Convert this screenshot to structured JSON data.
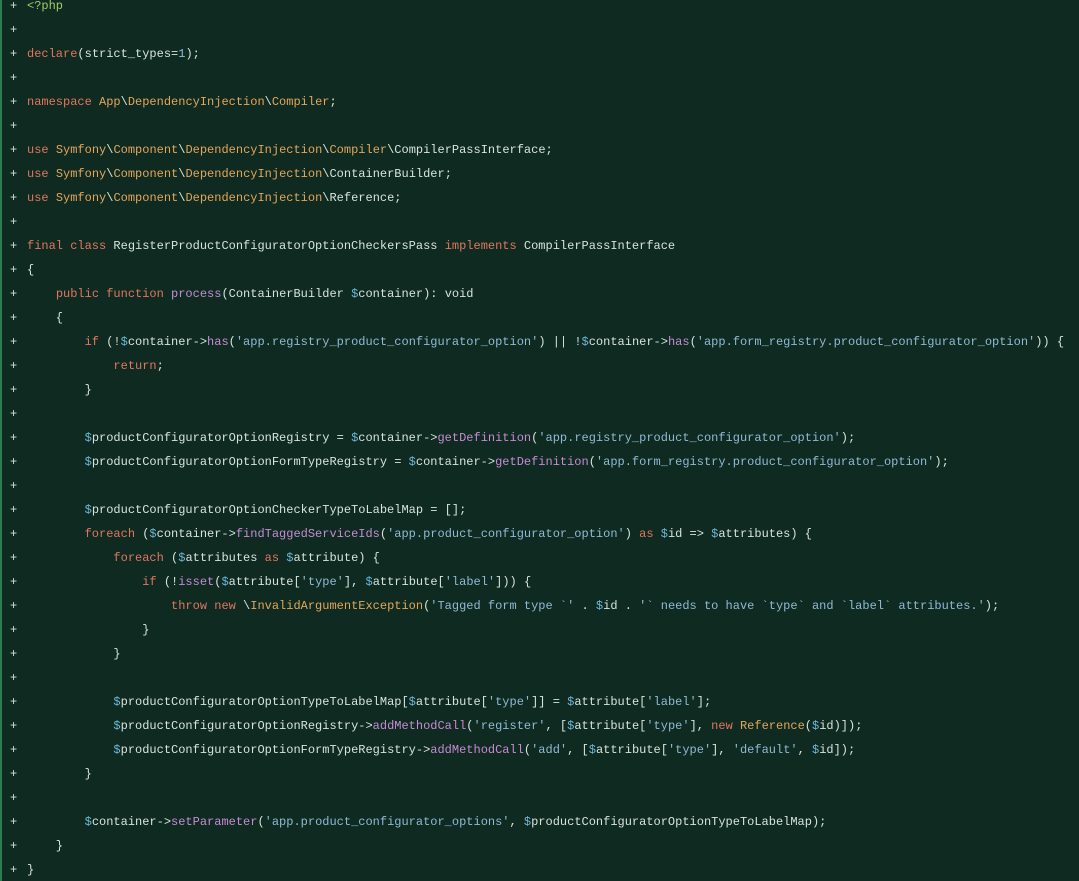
{
  "diff": {
    "marker": "+",
    "lines": [
      [
        [
          "tag",
          "<?php"
        ]
      ],
      [],
      [
        [
          "kw",
          "declare"
        ],
        [
          "plain",
          "(strict_types="
        ],
        [
          "num",
          "1"
        ],
        [
          "plain",
          ");"
        ]
      ],
      [],
      [
        [
          "kw",
          "namespace "
        ],
        [
          "ns",
          "App"
        ],
        [
          "plain",
          "\\"
        ],
        [
          "ns",
          "DependencyInjection"
        ],
        [
          "plain",
          "\\"
        ],
        [
          "ns",
          "Compiler"
        ],
        [
          "plain",
          ";"
        ]
      ],
      [],
      [
        [
          "kw",
          "use "
        ],
        [
          "ns",
          "Symfony"
        ],
        [
          "plain",
          "\\"
        ],
        [
          "ns",
          "Component"
        ],
        [
          "plain",
          "\\"
        ],
        [
          "ns",
          "DependencyInjection"
        ],
        [
          "plain",
          "\\"
        ],
        [
          "ns",
          "Compiler"
        ],
        [
          "plain",
          "\\CompilerPassInterface;"
        ]
      ],
      [
        [
          "kw",
          "use "
        ],
        [
          "ns",
          "Symfony"
        ],
        [
          "plain",
          "\\"
        ],
        [
          "ns",
          "Component"
        ],
        [
          "plain",
          "\\"
        ],
        [
          "ns",
          "DependencyInjection"
        ],
        [
          "plain",
          "\\ContainerBuilder;"
        ]
      ],
      [
        [
          "kw",
          "use "
        ],
        [
          "ns",
          "Symfony"
        ],
        [
          "plain",
          "\\"
        ],
        [
          "ns",
          "Component"
        ],
        [
          "plain",
          "\\"
        ],
        [
          "ns",
          "DependencyInjection"
        ],
        [
          "plain",
          "\\Reference;"
        ]
      ],
      [],
      [
        [
          "kw",
          "final class "
        ],
        [
          "plain",
          "RegisterProductConfiguratorOptionCheckersPass "
        ],
        [
          "kw",
          "implements "
        ],
        [
          "plain",
          "CompilerPassInterface"
        ]
      ],
      [
        [
          "plain",
          "{"
        ]
      ],
      [
        [
          "plain",
          "    "
        ],
        [
          "kw",
          "public function "
        ],
        [
          "fn",
          "process"
        ],
        [
          "plain",
          "(ContainerBuilder "
        ],
        [
          "var",
          "$"
        ],
        [
          "plain",
          "container): void"
        ]
      ],
      [
        [
          "plain",
          "    {"
        ]
      ],
      [
        [
          "plain",
          "        "
        ],
        [
          "kw",
          "if "
        ],
        [
          "plain",
          "(!"
        ],
        [
          "var",
          "$"
        ],
        [
          "plain",
          "container->"
        ],
        [
          "fn",
          "has"
        ],
        [
          "plain",
          "("
        ],
        [
          "str",
          "'app.registry_product_configurator_option'"
        ],
        [
          "plain",
          ") || !"
        ],
        [
          "var",
          "$"
        ],
        [
          "plain",
          "container->"
        ],
        [
          "fn",
          "has"
        ],
        [
          "plain",
          "("
        ],
        [
          "str",
          "'app.form_registry.product_configurator_option'"
        ],
        [
          "plain",
          ")) {"
        ]
      ],
      [
        [
          "plain",
          "            "
        ],
        [
          "kw",
          "return"
        ],
        [
          "plain",
          ";"
        ]
      ],
      [
        [
          "plain",
          "        }"
        ]
      ],
      [],
      [
        [
          "plain",
          "        "
        ],
        [
          "var",
          "$"
        ],
        [
          "plain",
          "productConfiguratorOptionRegistry = "
        ],
        [
          "var",
          "$"
        ],
        [
          "plain",
          "container->"
        ],
        [
          "fn",
          "getDefinition"
        ],
        [
          "plain",
          "("
        ],
        [
          "str",
          "'app.registry_product_configurator_option'"
        ],
        [
          "plain",
          ");"
        ]
      ],
      [
        [
          "plain",
          "        "
        ],
        [
          "var",
          "$"
        ],
        [
          "plain",
          "productConfiguratorOptionFormTypeRegistry = "
        ],
        [
          "var",
          "$"
        ],
        [
          "plain",
          "container->"
        ],
        [
          "fn",
          "getDefinition"
        ],
        [
          "plain",
          "("
        ],
        [
          "str",
          "'app.form_registry.product_configurator_option'"
        ],
        [
          "plain",
          ");"
        ]
      ],
      [],
      [
        [
          "plain",
          "        "
        ],
        [
          "var",
          "$"
        ],
        [
          "plain",
          "productConfiguratorOptionCheckerTypeToLabelMap = [];"
        ]
      ],
      [
        [
          "plain",
          "        "
        ],
        [
          "kw",
          "foreach "
        ],
        [
          "plain",
          "("
        ],
        [
          "var",
          "$"
        ],
        [
          "plain",
          "container->"
        ],
        [
          "fn",
          "findTaggedServiceIds"
        ],
        [
          "plain",
          "("
        ],
        [
          "str",
          "'app.product_configurator_option'"
        ],
        [
          "plain",
          ") "
        ],
        [
          "kw",
          "as "
        ],
        [
          "var",
          "$"
        ],
        [
          "plain",
          "id => "
        ],
        [
          "var",
          "$"
        ],
        [
          "plain",
          "attributes) {"
        ]
      ],
      [
        [
          "plain",
          "            "
        ],
        [
          "kw",
          "foreach "
        ],
        [
          "plain",
          "("
        ],
        [
          "var",
          "$"
        ],
        [
          "plain",
          "attributes "
        ],
        [
          "kw",
          "as "
        ],
        [
          "var",
          "$"
        ],
        [
          "plain",
          "attribute) {"
        ]
      ],
      [
        [
          "plain",
          "                "
        ],
        [
          "kw",
          "if "
        ],
        [
          "plain",
          "(!"
        ],
        [
          "fn",
          "isset"
        ],
        [
          "plain",
          "("
        ],
        [
          "var",
          "$"
        ],
        [
          "plain",
          "attribute["
        ],
        [
          "str",
          "'type'"
        ],
        [
          "plain",
          "], "
        ],
        [
          "var",
          "$"
        ],
        [
          "plain",
          "attribute["
        ],
        [
          "str",
          "'label'"
        ],
        [
          "plain",
          "])) {"
        ]
      ],
      [
        [
          "plain",
          "                    "
        ],
        [
          "kw",
          "throw new "
        ],
        [
          "plain",
          "\\"
        ],
        [
          "ns",
          "InvalidArgumentException"
        ],
        [
          "plain",
          "("
        ],
        [
          "str",
          "'Tagged form type `'"
        ],
        [
          "plain",
          " . "
        ],
        [
          "var",
          "$"
        ],
        [
          "plain",
          "id . "
        ],
        [
          "str",
          "'` needs to have `type` and `label` attributes.'"
        ],
        [
          "plain",
          ");"
        ]
      ],
      [
        [
          "plain",
          "                }"
        ]
      ],
      [
        [
          "plain",
          "            }"
        ]
      ],
      [],
      [
        [
          "plain",
          "            "
        ],
        [
          "var",
          "$"
        ],
        [
          "plain",
          "productConfiguratorOptionTypeToLabelMap["
        ],
        [
          "var",
          "$"
        ],
        [
          "plain",
          "attribute["
        ],
        [
          "str",
          "'type'"
        ],
        [
          "plain",
          "]] = "
        ],
        [
          "var",
          "$"
        ],
        [
          "plain",
          "attribute["
        ],
        [
          "str",
          "'label'"
        ],
        [
          "plain",
          "];"
        ]
      ],
      [
        [
          "plain",
          "            "
        ],
        [
          "var",
          "$"
        ],
        [
          "plain",
          "productConfiguratorOptionRegistry->"
        ],
        [
          "fn",
          "addMethodCall"
        ],
        [
          "plain",
          "("
        ],
        [
          "str",
          "'register'"
        ],
        [
          "plain",
          ", ["
        ],
        [
          "var",
          "$"
        ],
        [
          "plain",
          "attribute["
        ],
        [
          "str",
          "'type'"
        ],
        [
          "plain",
          "], "
        ],
        [
          "kw",
          "new "
        ],
        [
          "ns",
          "Reference"
        ],
        [
          "plain",
          "("
        ],
        [
          "var",
          "$"
        ],
        [
          "plain",
          "id)]);"
        ]
      ],
      [
        [
          "plain",
          "            "
        ],
        [
          "var",
          "$"
        ],
        [
          "plain",
          "productConfiguratorOptionFormTypeRegistry->"
        ],
        [
          "fn",
          "addMethodCall"
        ],
        [
          "plain",
          "("
        ],
        [
          "str",
          "'add'"
        ],
        [
          "plain",
          ", ["
        ],
        [
          "var",
          "$"
        ],
        [
          "plain",
          "attribute["
        ],
        [
          "str",
          "'type'"
        ],
        [
          "plain",
          "], "
        ],
        [
          "str",
          "'default'"
        ],
        [
          "plain",
          ", "
        ],
        [
          "var",
          "$"
        ],
        [
          "plain",
          "id]);"
        ]
      ],
      [
        [
          "plain",
          "        }"
        ]
      ],
      [],
      [
        [
          "plain",
          "        "
        ],
        [
          "var",
          "$"
        ],
        [
          "plain",
          "container->"
        ],
        [
          "fn",
          "setParameter"
        ],
        [
          "plain",
          "("
        ],
        [
          "str",
          "'app.product_configurator_options'"
        ],
        [
          "plain",
          ", "
        ],
        [
          "var",
          "$"
        ],
        [
          "plain",
          "productConfiguratorOptionTypeToLabelMap);"
        ]
      ],
      [
        [
          "plain",
          "    }"
        ]
      ],
      [
        [
          "plain",
          "}"
        ]
      ]
    ]
  }
}
